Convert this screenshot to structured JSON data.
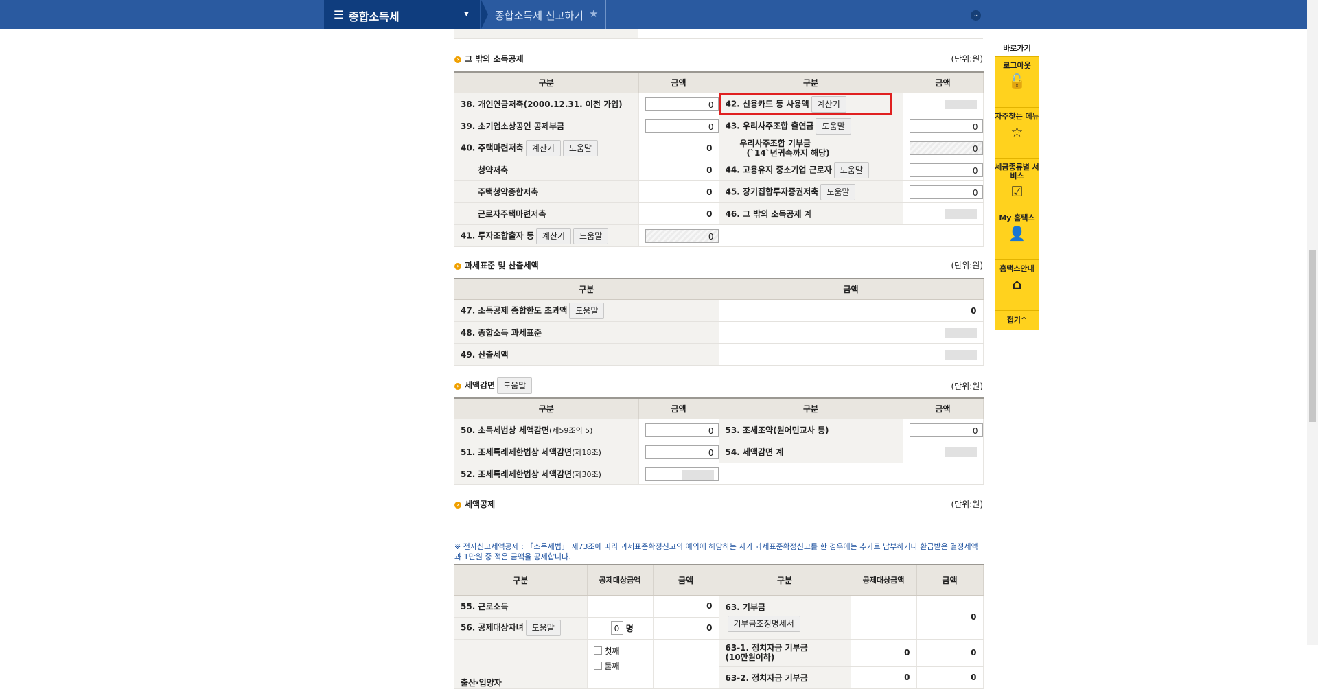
{
  "header": {
    "menu_label": "종합소득세",
    "breadcrumb": "종합소득세 신고하기"
  },
  "side": {
    "title": "바로가기",
    "items": [
      "로그아웃",
      "자주찾는 메뉴",
      "세금종류별 서비스",
      "My 홈택스",
      "홈택스안내"
    ],
    "fold": "접기^"
  },
  "common": {
    "unit": "(단위:원)",
    "col_gubun": "구분",
    "col_amount": "금액",
    "col_target": "공제대상금액",
    "help": "도움말",
    "calc": "계산기",
    "zero": "0"
  },
  "sec1": {
    "title": "그 밖의 소득공제",
    "left": [
      "38. 개인연금저축(2000.12.31. 이전 가입)",
      "39. 소기업소상공인 공제부금",
      "40. 주택마련저축",
      "청약저축",
      "주택청약종합저축",
      "근로자주택마련저축",
      "41. 투자조합출자 등"
    ],
    "right": [
      "42. 신용카드 등 사용액",
      "43. 우리사주조합 출연금",
      "우리사주조합 기부금",
      "(`14`년귀속까지 해당)",
      "44. 고용유지 중소기업 근로자",
      "45. 장기집합투자증권저축",
      "46. 그 밖의 소득공제 계"
    ]
  },
  "sec2": {
    "title": "과세표준 및 산출세액",
    "rows": [
      "47. 소득공제 종합한도 초과액",
      "48. 종합소득 과세표준",
      "49. 산출세액"
    ]
  },
  "sec3": {
    "title": "세액감면",
    "left": [
      "50. 소득세법상 세액감면",
      "51. 조세특례제한법상 세액감면",
      "52. 조세특례제한법상 세액감면"
    ],
    "left_small": [
      "(제59조의 5)",
      "(제18조)",
      "(제30조)"
    ],
    "right": [
      "53. 조세조약(원어민교사 등)",
      "54. 세액감면 계"
    ]
  },
  "sec4": {
    "title": "세액공제",
    "note": "※ 전자신고세액공제 : 「소득세법」 제73조에 따라 과세표준확정신고의 예외에 해당하는 자가 과세표준확정신고를 한 경우에는 추가로 납부하거나 환급받은 결정세액과 1만원 중 적은 금액을 공제합니다.",
    "left": [
      "55. 근로소득",
      "56. 공제대상자녀",
      "출산·입양자"
    ],
    "person_unit": "명",
    "child1": "첫째",
    "child2": "둘째",
    "right": [
      "63. 기부금",
      "기부금조정명세서",
      "63-1. 정치자금 기부금",
      "(10만원이하)",
      "63-2. 정치자금 기부금"
    ]
  }
}
